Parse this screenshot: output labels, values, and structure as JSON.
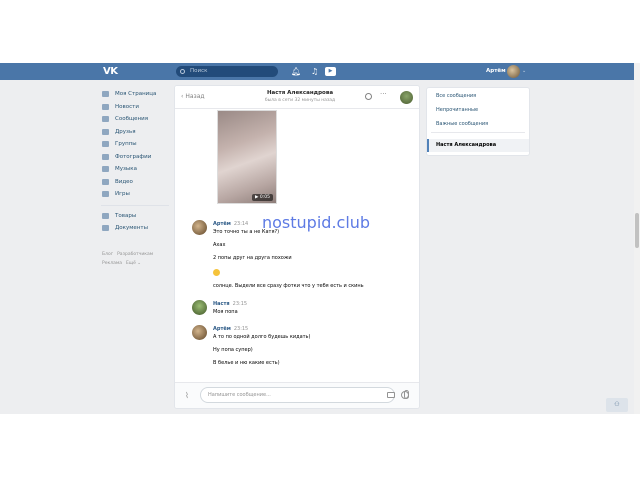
{
  "header": {
    "logo": "VK",
    "search_placeholder": "Поиск",
    "icons": [
      "bell-icon",
      "music-icon",
      "play-icon"
    ],
    "username": "Артём",
    "accent": "#4a76a8"
  },
  "left_menu": {
    "items": [
      {
        "label": "Моя Страница",
        "icon": "home-icon"
      },
      {
        "label": "Новости",
        "icon": "news-icon"
      },
      {
        "label": "Сообщения",
        "icon": "messages-icon"
      },
      {
        "label": "Друзья",
        "icon": "friends-icon"
      },
      {
        "label": "Группы",
        "icon": "groups-icon"
      },
      {
        "label": "Фотографии",
        "icon": "photos-icon"
      },
      {
        "label": "Музыка",
        "icon": "music-icon"
      },
      {
        "label": "Видео",
        "icon": "video-icon"
      },
      {
        "label": "Игры",
        "icon": "games-icon"
      }
    ],
    "items2": [
      {
        "label": "Товары",
        "icon": "goods-icon"
      },
      {
        "label": "Документы",
        "icon": "documents-icon"
      }
    ],
    "footer": [
      "Блог",
      "Разработчикам",
      "Реклама",
      "Ещё ⌄"
    ]
  },
  "chat": {
    "back_label": "Назад",
    "title": "Настя Александрова",
    "status": "была в сети 32 минуты назад",
    "video_duration": "0:05",
    "messages": [
      {
        "author": "Артём",
        "time": "23:14",
        "lines": [
          "Это точно ты а не Катя?)",
          "Ахах",
          "2 попы друг на друга похожи",
          "",
          "солнце. Выдели все сразу фотки что у тебя есть и скинь"
        ]
      },
      {
        "author": "Настя",
        "time": "23:15",
        "lines": [
          "Моя попа"
        ]
      },
      {
        "author": "Артём",
        "time": "23:15",
        "lines": [
          "А то по одной долго будешь кидать)",
          "Ну попа супер)",
          "В белье и ню какие есть)"
        ]
      }
    ],
    "input_placeholder": "Напишите сообщение..."
  },
  "watermark": "nostupid.club",
  "right_panel": {
    "items": [
      "Все сообщения",
      "Непрочитанные",
      "Важные сообщения"
    ],
    "active": "Настя Александрова"
  }
}
